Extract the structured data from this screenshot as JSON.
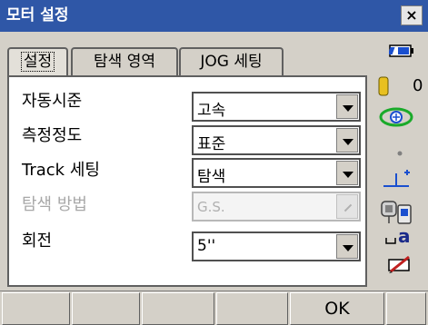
{
  "window": {
    "title": "모터 설정",
    "close_label": "×"
  },
  "tabs": [
    {
      "label": "설정",
      "active": true
    },
    {
      "label": "탐색 영역",
      "active": false
    },
    {
      "label": "JOG 세팅",
      "active": false
    }
  ],
  "fields": [
    {
      "label": "자동시준",
      "value": "고속",
      "enabled": true
    },
    {
      "label": "측정정도",
      "value": "표준",
      "enabled": true
    },
    {
      "label": "Track 세팅",
      "value": "탐색",
      "enabled": true
    },
    {
      "label": "탐색 방법",
      "value": "G.S.",
      "enabled": false
    },
    {
      "label": "회전",
      "value": "5''",
      "enabled": true
    }
  ],
  "status": {
    "battery_icon": "battery-icon",
    "prism_constant": "0",
    "target_icon": "target-icon",
    "dot_icon": "signal-dot-icon",
    "level_icon": "tilt-level-icon",
    "device_icon": "instrument-icon",
    "input_mode": "a",
    "edit_icon": "pencil-eraser-icon"
  },
  "softkeys": [
    "",
    "",
    "",
    "",
    "OK",
    ""
  ],
  "colors": {
    "titlebar": "#2f57a7",
    "background": "#d4d0c8",
    "panel": "#ffffff"
  }
}
